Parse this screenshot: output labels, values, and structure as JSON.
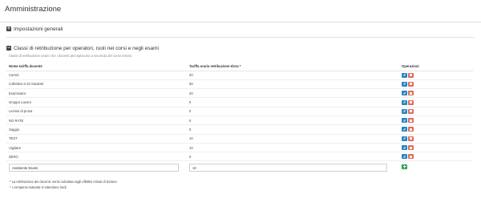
{
  "page": {
    "title": "Amministrazione"
  },
  "settings_panel": {
    "title": "Impostazioni generali",
    "toggle": "+"
  },
  "classes_panel": {
    "toggle": "−",
    "title": "Classi di retribuzione per operatori, ruoli nei corsi e negli esami",
    "description": "Classi di retribuzione orarie che i docenti percepiscono a seconda del corso tenuto",
    "columns": {
      "name": "Nome tariffa docente",
      "rate": "Tariffa oraria retribuzione €/ora *",
      "ops": "Operazioni"
    },
    "rows": [
      {
        "name": "Carnet",
        "rate": "20"
      },
      {
        "name": "Collettivo 6-10 Studenti",
        "rate": "50"
      },
      {
        "name": "Examinator",
        "rate": "20"
      },
      {
        "name": "Gruppo Lavoro",
        "rate": "0"
      },
      {
        "name": "Lezioni di prova",
        "rate": "0"
      },
      {
        "name": "NO RATE",
        "rate": "0"
      },
      {
        "name": "Saggio",
        "rate": "0"
      },
      {
        "name": "TEST",
        "rate": "10"
      },
      {
        "name": "Vigilator",
        "rate": "10"
      },
      {
        "name": "ZERO",
        "rate": "0"
      }
    ],
    "new_row": {
      "name_value": "Assistente Esami",
      "rate_value": "10"
    }
  },
  "footnotes": [
    "* La retribuzione dei docenti, verrà calcolata sugli effettivi minuti di lezione",
    "* I compensi maturati si intendono lordi"
  ],
  "icons": {
    "edit": "pencil-icon",
    "delete": "trash-icon",
    "add": "plus-icon"
  },
  "colors": {
    "edit": "#2a86c4",
    "delete": "#e06b5b",
    "add": "#2ea04f"
  }
}
